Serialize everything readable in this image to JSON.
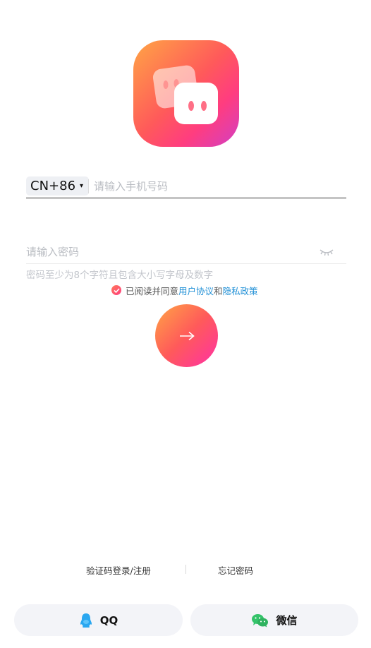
{
  "app": {
    "logo_icon": "app-logo-icon"
  },
  "login": {
    "country_code": "CN+86",
    "country_caret": "▾",
    "phone_placeholder": "请输入手机号码",
    "password_placeholder": "请输入密码",
    "password_hint": "密码至少为8个字符且包含大小写字母及数字",
    "agree_prefix": "已阅读并同意",
    "agree_user_agreement": "用户协议",
    "agree_and": "和",
    "agree_privacy": "隐私政策",
    "submit_icon": "arrow-right-icon"
  },
  "links": {
    "sms_login": "验证码登录/注册",
    "forgot_password": "忘记密码"
  },
  "social": {
    "qq_label": "QQ",
    "wechat_label": "微信"
  },
  "colors": {
    "accent_start": "#ffa545",
    "accent_end": "#e040b0",
    "link": "#1f8fd6"
  }
}
